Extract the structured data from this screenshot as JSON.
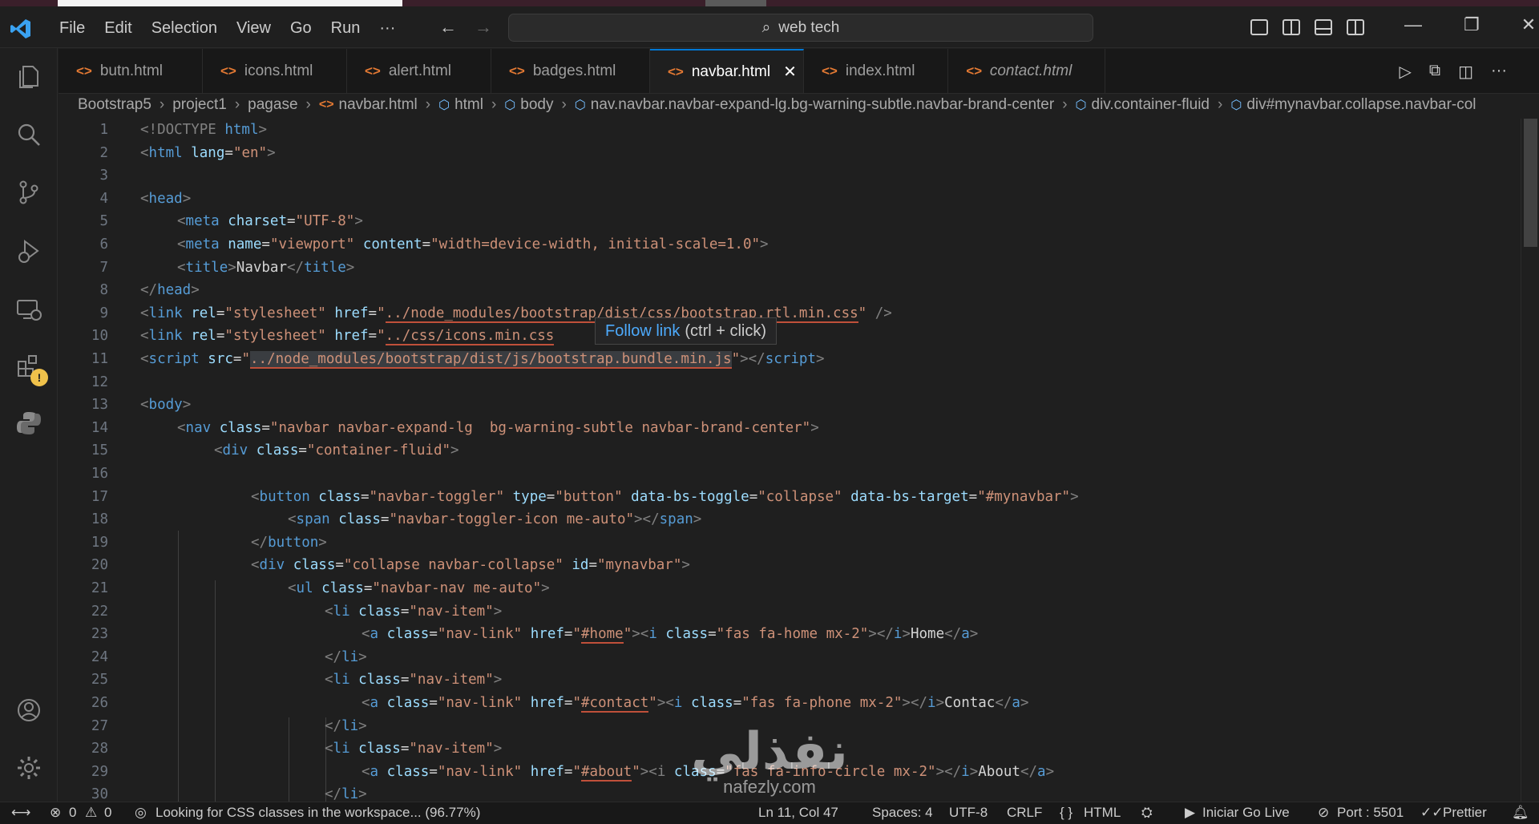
{
  "menu": [
    "File",
    "Edit",
    "Selection",
    "View",
    "Go",
    "Run",
    "···"
  ],
  "search": {
    "text": "web tech"
  },
  "tabs": [
    {
      "label": "butn.html"
    },
    {
      "label": "icons.html"
    },
    {
      "label": "alert.html"
    },
    {
      "label": "badges.html"
    },
    {
      "label": "navbar.html",
      "close": "✕"
    },
    {
      "label": "index.html"
    },
    {
      "label": "contact.html"
    }
  ],
  "breadcrumb": [
    "Bootstrap5",
    "project1",
    "pagase",
    "navbar.html",
    "html",
    "body",
    "nav.navbar.navbar-expand-lg.bg-warning-subtle.navbar-brand-center",
    "div.container-fluid",
    "div#mynavbar.collapse.navbar-col"
  ],
  "line_numbers": [
    "1",
    "2",
    "3",
    "4",
    "5",
    "6",
    "7",
    "8",
    "9",
    "10",
    "11",
    "12",
    "13",
    "14",
    "15",
    "16",
    "17",
    "18",
    "19",
    "20",
    "21",
    "22",
    "23",
    "24",
    "25",
    "26",
    "27",
    "28",
    "29",
    "30"
  ],
  "code": {
    "l1": {
      "a": "<!DOCTYPE ",
      "b": "html",
      "c": ">"
    },
    "l2": {
      "a": "<",
      "b": "html",
      "c": " lang",
      "d": "=",
      "e": "\"en\"",
      "f": ">"
    },
    "l4": {
      "a": "<",
      "b": "head",
      "c": ">"
    },
    "l5": {
      "a": "<",
      "b": "meta",
      "c": " charset",
      "d": "=",
      "e": "\"UTF-8\"",
      "f": ">"
    },
    "l6": {
      "a": "<",
      "b": "meta",
      "c": " name",
      "d": "=",
      "e": "\"viewport\"",
      "f": " content",
      "g": "=",
      "h": "\"width=device-width, initial-scale=1.0\"",
      "i": ">"
    },
    "l7": {
      "a": "<",
      "b": "title",
      "c": ">",
      "d": "Navbar",
      "e": "</",
      "f": "title",
      "g": ">"
    },
    "l8": {
      "a": "</",
      "b": "head",
      "c": ">"
    },
    "l9": {
      "a": "<",
      "b": "link",
      "c": " rel",
      "d": "=",
      "e": "\"stylesheet\"",
      "f": " href",
      "g": "=",
      "h": "\"",
      "i": "../node_modules/bootstrap/dist/css/bootstrap.rtl.min.css",
      "j": "\"",
      "k": " />"
    },
    "l10": {
      "a": "<",
      "b": "link",
      "c": " rel",
      "d": "=",
      "e": "\"stylesheet\"",
      "f": " href",
      "g": "=",
      "h": "\"",
      "i": "../css/icons.min.css"
    },
    "l11": {
      "a": "<",
      "b": "script",
      "c": " src",
      "d": "=",
      "e": "\"",
      "f": "../node_modules/bootstrap/dist/js/bootstrap.bundle.min.js",
      "g": "\"",
      "h": "></",
      "i": "script",
      "j": ">"
    },
    "l13": {
      "a": "<",
      "b": "body",
      "c": ">"
    },
    "l14": {
      "a": "<",
      "b": "nav",
      "c": " class",
      "d": "=",
      "e": "\"navbar navbar-expand-lg  bg-warning-subtle navbar-brand-center\"",
      "f": ">"
    },
    "l15": {
      "a": "<",
      "b": "div",
      "c": " class",
      "d": "=",
      "e": "\"container-fluid\"",
      "f": ">"
    },
    "l17": {
      "a": "<",
      "b": "button",
      "c": " class",
      "d": "=",
      "e": "\"navbar-toggler\"",
      "f": " type",
      "g": "=",
      "h": "\"button\"",
      "i": " data-bs-toggle",
      "j": "=",
      "k": "\"collapse\"",
      "l": " data-bs-target",
      "m": "=",
      "n": "\"#mynavbar\"",
      "o": ">"
    },
    "l18": {
      "a": "<",
      "b": "span",
      "c": " class",
      "d": "=",
      "e": "\"navbar-toggler-icon me-auto\"",
      "f": "></",
      "g": "span",
      "h": ">"
    },
    "l19": {
      "a": "</",
      "b": "button",
      "c": ">"
    },
    "l20": {
      "a": "<",
      "b": "div",
      "c": " class",
      "d": "=",
      "e": "\"collapse navbar-collapse\"",
      "f": " id",
      "g": "=",
      "h": "\"mynavbar\"",
      "i": ">"
    },
    "l21": {
      "a": "<",
      "b": "ul",
      "c": " class",
      "d": "=",
      "e": "\"navbar-nav me-auto\"",
      "f": ">"
    },
    "l22": {
      "a": "<",
      "b": "li",
      "c": " class",
      "d": "=",
      "e": "\"nav-item\"",
      "f": ">"
    },
    "l23": {
      "a": "<",
      "b": "a",
      "c": " class",
      "d": "=",
      "e": "\"nav-link\"",
      "f": " href",
      "g": "=",
      "h": "\"",
      "i": "#home",
      "j": "\"",
      "k": "><",
      "l": "i",
      "m": " class",
      "n": "=",
      "o": "\"fas fa-home mx-2\"",
      "p": "></",
      "q": "i",
      "r": ">",
      "s": "Home",
      "t": "</",
      "u": "a",
      "v": ">"
    },
    "l24": {
      "a": "</",
      "b": "li",
      "c": ">"
    },
    "l25": {
      "a": "<",
      "b": "li",
      "c": " class",
      "d": "=",
      "e": "\"nav-item\"",
      "f": ">"
    },
    "l26": {
      "a": "<",
      "b": "a",
      "c": " class",
      "d": "=",
      "e": "\"nav-link\"",
      "f": " href",
      "g": "=",
      "h": "\"",
      "i": "#contact",
      "j": "\"",
      "k": "><",
      "l": "i",
      "m": " class",
      "n": "=",
      "o": "\"fas fa-phone mx-2\"",
      "p": "></",
      "q": "i",
      "r": ">",
      "s": "Contac",
      "t": "</",
      "u": "a",
      "v": ">"
    },
    "l27": {
      "a": "</",
      "b": "li",
      "c": ">"
    },
    "l28": {
      "a": "<",
      "b": "li",
      "c": " class",
      "d": "=",
      "e": "\"nav-item\"",
      "f": ">"
    },
    "l29": {
      "a": "<",
      "b": "a",
      "c": " class",
      "d": "=",
      "e": "\"nav-link\"",
      "f": " href",
      "g": "=",
      "h": "\"",
      "i": "#about",
      "j": "\"",
      "k": "><i ",
      "l": "class",
      "m": "=",
      "n": "\"fas fa-info-circle mx-2\"",
      "o": "></",
      "p": "i",
      "q": ">",
      "r": "About",
      "s": "</",
      "t": "a",
      "u": ">"
    },
    "l30": {
      "a": "</",
      "b": "li",
      "c": ">"
    }
  },
  "tooltip": {
    "link": "Follow link",
    "hint": "(ctrl + click)"
  },
  "watermark": {
    "arabic": "نفذلي",
    "latin": "nafezly.com"
  },
  "status": {
    "remote": "⟷",
    "errors": "0",
    "warnings": "0",
    "message": "Looking for CSS classes in the workspace... (96.77%)",
    "position": "Ln 11, Col 47",
    "spaces": "Spaces: 4",
    "encoding": "UTF-8",
    "eol": "CRLF",
    "language": "HTML",
    "golive": "Iniciar Go Live",
    "port": "Port : 5501",
    "prettier": "Prettier"
  },
  "colors": {
    "accent": "#0078d4",
    "tag": "#569cd6",
    "attr": "#9cdcfe",
    "string": "#ce9178",
    "bracket": "#808080",
    "html_icon": "#e37933"
  }
}
